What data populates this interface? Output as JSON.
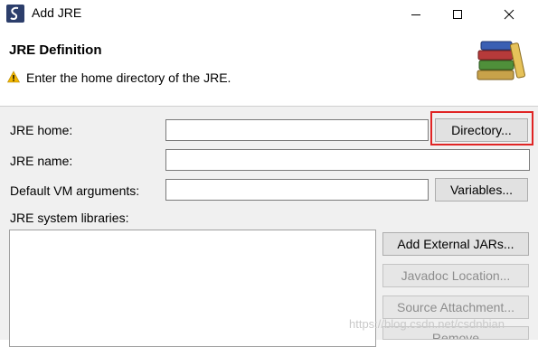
{
  "window": {
    "title": "Add JRE"
  },
  "header": {
    "title": "JRE Definition",
    "message": "Enter the home directory of the JRE."
  },
  "form": {
    "jre_home_label": "JRE home:",
    "jre_home_value": "",
    "directory_button": "Directory...",
    "jre_name_label": "JRE name:",
    "jre_name_value": "",
    "vm_args_label": "Default VM arguments:",
    "vm_args_value": "",
    "variables_button": "Variables...",
    "system_libraries_label": "JRE system libraries:"
  },
  "library_buttons": {
    "add_external_jars": "Add External JARs...",
    "javadoc_location": "Javadoc Location...",
    "source_attachment": "Source Attachment...",
    "remove": "Remove"
  },
  "watermark": "https://blog.csdn.net/csdnbian",
  "colors": {
    "highlight": "#e02424",
    "dialog_bg": "#f0f0f0",
    "warning": "#f2b600"
  }
}
